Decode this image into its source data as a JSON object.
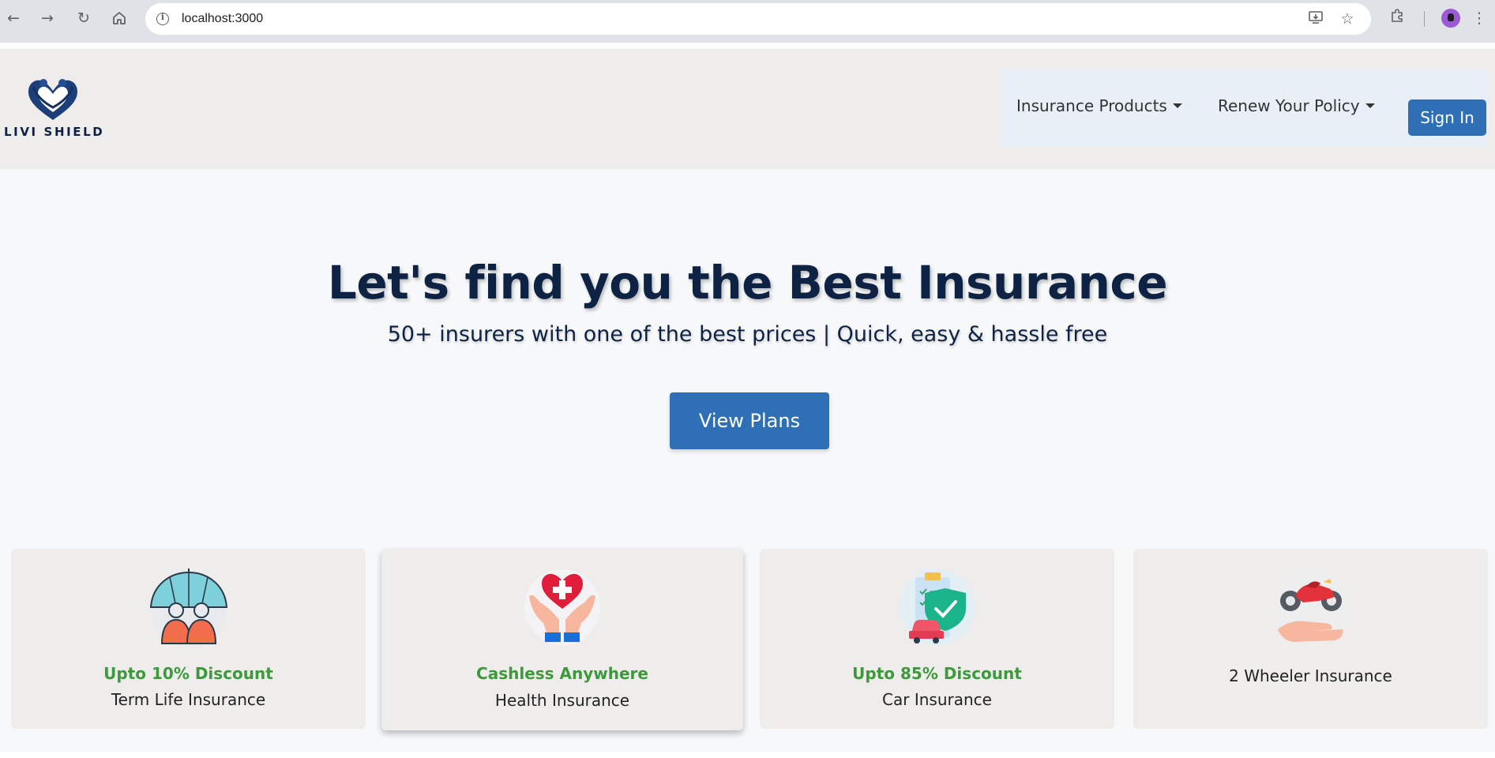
{
  "browser": {
    "url": "localhost:3000"
  },
  "header": {
    "logo_text": "LIVI SHIELD",
    "nav": [
      {
        "label": "Insurance Products"
      },
      {
        "label": "Renew Your Policy"
      }
    ],
    "sign_in_label": "Sign In"
  },
  "hero": {
    "title": "Let's find you the Best Insurance",
    "subtitle": "50+ insurers with one of the best prices | Quick, easy & hassle free",
    "cta_label": "View Plans"
  },
  "cards": [
    {
      "icon": "umbrella-family-icon",
      "highlight": "Upto 10% Discount",
      "label": "Term Life Insurance"
    },
    {
      "icon": "hands-heart-icon",
      "highlight": "Cashless Anywhere",
      "label": "Health Insurance"
    },
    {
      "icon": "car-shield-icon",
      "highlight": "Upto 85% Discount",
      "label": "Car Insurance"
    },
    {
      "icon": "motorbike-hand-icon",
      "highlight": "",
      "label": "2 Wheeler Insurance"
    }
  ],
  "colors": {
    "primary_blue": "#2e6fb5",
    "navy_text": "#0e2344",
    "highlight_green": "#3c9a3a",
    "card_bg": "#efedeb"
  }
}
